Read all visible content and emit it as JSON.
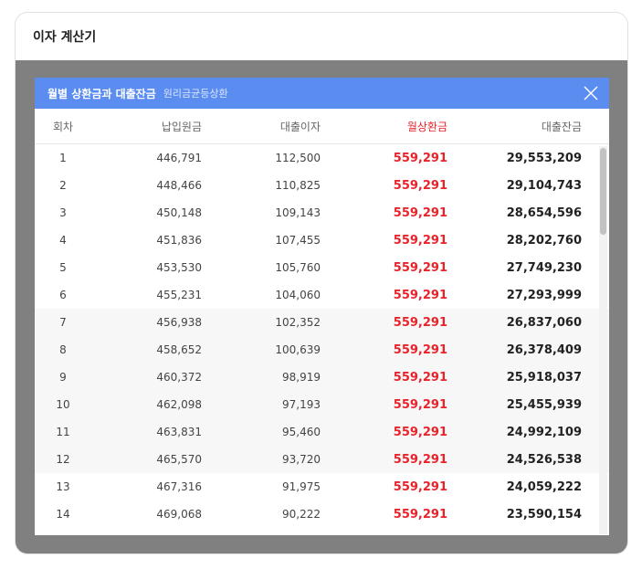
{
  "card": {
    "title": "이자 계산기"
  },
  "modal": {
    "title": "월별 상환금과 대출잔금",
    "subtitle": "원리금균등상환"
  },
  "columns": [
    "회차",
    "납입원금",
    "대출이자",
    "월상환금",
    "대출잔금"
  ],
  "rows": [
    [
      "1",
      "446,791",
      "112,500",
      "559,291",
      "29,553,209"
    ],
    [
      "2",
      "448,466",
      "110,825",
      "559,291",
      "29,104,743"
    ],
    [
      "3",
      "450,148",
      "109,143",
      "559,291",
      "28,654,596"
    ],
    [
      "4",
      "451,836",
      "107,455",
      "559,291",
      "28,202,760"
    ],
    [
      "5",
      "453,530",
      "105,760",
      "559,291",
      "27,749,230"
    ],
    [
      "6",
      "455,231",
      "104,060",
      "559,291",
      "27,293,999"
    ],
    [
      "7",
      "456,938",
      "102,352",
      "559,291",
      "26,837,060"
    ],
    [
      "8",
      "458,652",
      "100,639",
      "559,291",
      "26,378,409"
    ],
    [
      "9",
      "460,372",
      "98,919",
      "559,291",
      "25,918,037"
    ],
    [
      "10",
      "462,098",
      "97,193",
      "559,291",
      "25,455,939"
    ],
    [
      "11",
      "463,831",
      "95,460",
      "559,291",
      "24,992,109"
    ],
    [
      "12",
      "465,570",
      "93,720",
      "559,291",
      "24,526,538"
    ],
    [
      "13",
      "467,316",
      "91,975",
      "559,291",
      "24,059,222"
    ],
    [
      "14",
      "469,068",
      "90,222",
      "559,291",
      "23,590,154"
    ]
  ],
  "colors": {
    "header_blue": "#5b8cf0",
    "accent_red": "#e8232b"
  }
}
